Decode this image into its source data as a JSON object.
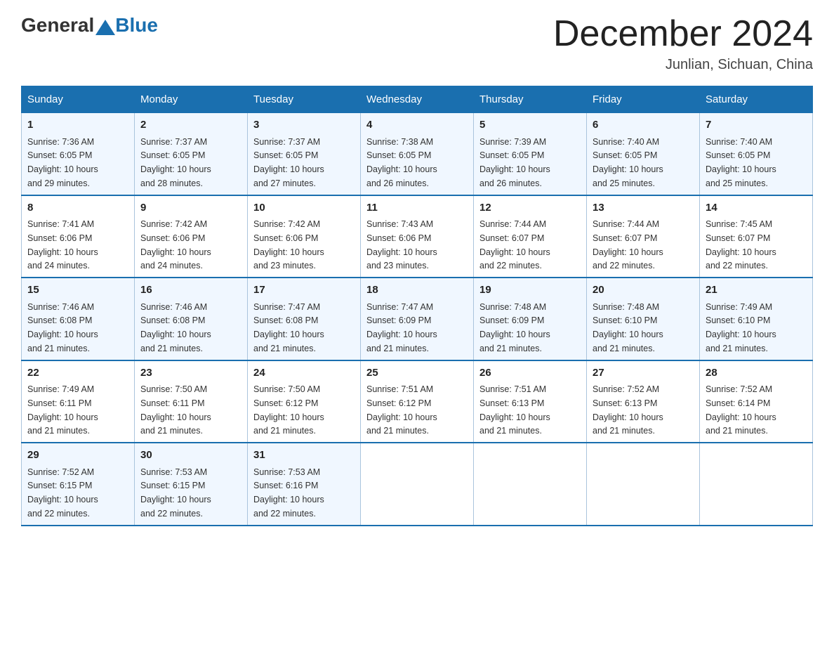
{
  "header": {
    "logo_general": "General",
    "logo_blue": "Blue",
    "month_title": "December 2024",
    "location": "Junlian, Sichuan, China"
  },
  "weekdays": [
    "Sunday",
    "Monday",
    "Tuesday",
    "Wednesday",
    "Thursday",
    "Friday",
    "Saturday"
  ],
  "weeks": [
    [
      {
        "day": "1",
        "sunrise": "7:36 AM",
        "sunset": "6:05 PM",
        "daylight": "10 hours and 29 minutes."
      },
      {
        "day": "2",
        "sunrise": "7:37 AM",
        "sunset": "6:05 PM",
        "daylight": "10 hours and 28 minutes."
      },
      {
        "day": "3",
        "sunrise": "7:37 AM",
        "sunset": "6:05 PM",
        "daylight": "10 hours and 27 minutes."
      },
      {
        "day": "4",
        "sunrise": "7:38 AM",
        "sunset": "6:05 PM",
        "daylight": "10 hours and 26 minutes."
      },
      {
        "day": "5",
        "sunrise": "7:39 AM",
        "sunset": "6:05 PM",
        "daylight": "10 hours and 26 minutes."
      },
      {
        "day": "6",
        "sunrise": "7:40 AM",
        "sunset": "6:05 PM",
        "daylight": "10 hours and 25 minutes."
      },
      {
        "day": "7",
        "sunrise": "7:40 AM",
        "sunset": "6:05 PM",
        "daylight": "10 hours and 25 minutes."
      }
    ],
    [
      {
        "day": "8",
        "sunrise": "7:41 AM",
        "sunset": "6:06 PM",
        "daylight": "10 hours and 24 minutes."
      },
      {
        "day": "9",
        "sunrise": "7:42 AM",
        "sunset": "6:06 PM",
        "daylight": "10 hours and 24 minutes."
      },
      {
        "day": "10",
        "sunrise": "7:42 AM",
        "sunset": "6:06 PM",
        "daylight": "10 hours and 23 minutes."
      },
      {
        "day": "11",
        "sunrise": "7:43 AM",
        "sunset": "6:06 PM",
        "daylight": "10 hours and 23 minutes."
      },
      {
        "day": "12",
        "sunrise": "7:44 AM",
        "sunset": "6:07 PM",
        "daylight": "10 hours and 22 minutes."
      },
      {
        "day": "13",
        "sunrise": "7:44 AM",
        "sunset": "6:07 PM",
        "daylight": "10 hours and 22 minutes."
      },
      {
        "day": "14",
        "sunrise": "7:45 AM",
        "sunset": "6:07 PM",
        "daylight": "10 hours and 22 minutes."
      }
    ],
    [
      {
        "day": "15",
        "sunrise": "7:46 AM",
        "sunset": "6:08 PM",
        "daylight": "10 hours and 21 minutes."
      },
      {
        "day": "16",
        "sunrise": "7:46 AM",
        "sunset": "6:08 PM",
        "daylight": "10 hours and 21 minutes."
      },
      {
        "day": "17",
        "sunrise": "7:47 AM",
        "sunset": "6:08 PM",
        "daylight": "10 hours and 21 minutes."
      },
      {
        "day": "18",
        "sunrise": "7:47 AM",
        "sunset": "6:09 PM",
        "daylight": "10 hours and 21 minutes."
      },
      {
        "day": "19",
        "sunrise": "7:48 AM",
        "sunset": "6:09 PM",
        "daylight": "10 hours and 21 minutes."
      },
      {
        "day": "20",
        "sunrise": "7:48 AM",
        "sunset": "6:10 PM",
        "daylight": "10 hours and 21 minutes."
      },
      {
        "day": "21",
        "sunrise": "7:49 AM",
        "sunset": "6:10 PM",
        "daylight": "10 hours and 21 minutes."
      }
    ],
    [
      {
        "day": "22",
        "sunrise": "7:49 AM",
        "sunset": "6:11 PM",
        "daylight": "10 hours and 21 minutes."
      },
      {
        "day": "23",
        "sunrise": "7:50 AM",
        "sunset": "6:11 PM",
        "daylight": "10 hours and 21 minutes."
      },
      {
        "day": "24",
        "sunrise": "7:50 AM",
        "sunset": "6:12 PM",
        "daylight": "10 hours and 21 minutes."
      },
      {
        "day": "25",
        "sunrise": "7:51 AM",
        "sunset": "6:12 PM",
        "daylight": "10 hours and 21 minutes."
      },
      {
        "day": "26",
        "sunrise": "7:51 AM",
        "sunset": "6:13 PM",
        "daylight": "10 hours and 21 minutes."
      },
      {
        "day": "27",
        "sunrise": "7:52 AM",
        "sunset": "6:13 PM",
        "daylight": "10 hours and 21 minutes."
      },
      {
        "day": "28",
        "sunrise": "7:52 AM",
        "sunset": "6:14 PM",
        "daylight": "10 hours and 21 minutes."
      }
    ],
    [
      {
        "day": "29",
        "sunrise": "7:52 AM",
        "sunset": "6:15 PM",
        "daylight": "10 hours and 22 minutes."
      },
      {
        "day": "30",
        "sunrise": "7:53 AM",
        "sunset": "6:15 PM",
        "daylight": "10 hours and 22 minutes."
      },
      {
        "day": "31",
        "sunrise": "7:53 AM",
        "sunset": "6:16 PM",
        "daylight": "10 hours and 22 minutes."
      },
      null,
      null,
      null,
      null
    ]
  ],
  "labels": {
    "sunrise": "Sunrise:",
    "sunset": "Sunset:",
    "daylight": "Daylight:"
  }
}
